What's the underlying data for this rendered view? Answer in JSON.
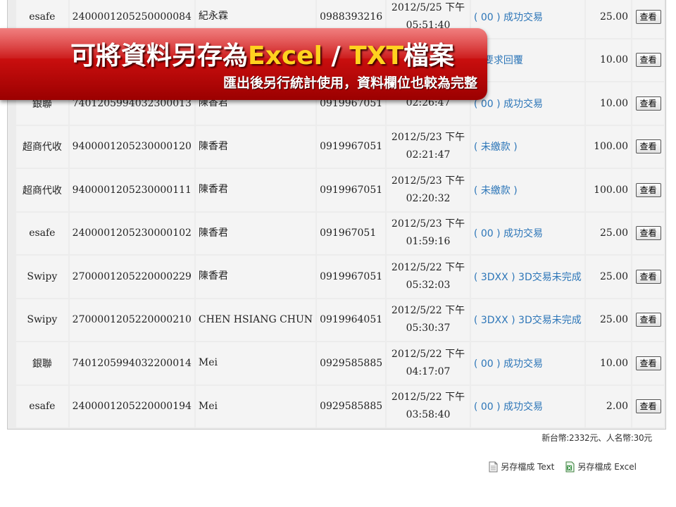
{
  "banner": {
    "title_part1": "可將資料另存為",
    "title_excel": "Excel",
    "title_sep": " / ",
    "title_txt": "TXT",
    "title_part2": "檔案",
    "subtitle": "匯出後另行統計使用，資料欄位也較為完整"
  },
  "rows": [
    {
      "method": "esafe",
      "order_no": "2400001205250000084",
      "name": "紀永霖",
      "phone": "0988393216",
      "date": "2012/5/25 下午",
      "time": "05:51:40",
      "status": "( 00 ) 成功交易",
      "amount": "25.00",
      "action": "查看"
    },
    {
      "method": "",
      "order_no": "",
      "name": "",
      "phone": "",
      "date": "",
      "time": "",
      "status": "行要求回覆",
      "amount": "10.00",
      "action": "查看"
    },
    {
      "method": "銀聯",
      "order_no": "7401205994032300013",
      "name": "陳香君",
      "phone": "0919967051",
      "date": "",
      "time": "02:26:47",
      "status": "( 00 ) 成功交易",
      "amount": "10.00",
      "action": "查看"
    },
    {
      "method": "超商代收",
      "order_no": "9400001205230000120",
      "name": "陳香君",
      "phone": "0919967051",
      "date": "2012/5/23 下午",
      "time": "02:21:47",
      "status": "( 未繳款 )",
      "amount": "100.00",
      "action": "查看"
    },
    {
      "method": "超商代收",
      "order_no": "9400001205230000111",
      "name": "陳香君",
      "phone": "0919967051",
      "date": "2012/5/23 下午",
      "time": "02:20:32",
      "status": "( 未繳款 )",
      "amount": "100.00",
      "action": "查看"
    },
    {
      "method": "esafe",
      "order_no": "2400001205230000102",
      "name": "陳香君",
      "phone": "091967051",
      "date": "2012/5/23 下午",
      "time": "01:59:16",
      "status": "( 00 ) 成功交易",
      "amount": "25.00",
      "action": "查看"
    },
    {
      "method": "Swipy",
      "order_no": "2700001205220000229",
      "name": "陳香君",
      "phone": "0919967051",
      "date": "2012/5/22 下午",
      "time": "05:32:03",
      "status": "( 3DXX ) 3D交易未完成",
      "amount": "25.00",
      "action": "查看"
    },
    {
      "method": "Swipy",
      "order_no": "2700001205220000210",
      "name": "CHEN HSIANG CHUN",
      "phone": "0919964051",
      "date": "2012/5/22 下午",
      "time": "05:30:37",
      "status": "( 3DXX ) 3D交易未完成",
      "amount": "25.00",
      "action": "查看"
    },
    {
      "method": "銀聯",
      "order_no": "7401205994032200014",
      "name": "Mei",
      "phone": "0929585885",
      "date": "2012/5/22 下午",
      "time": "04:17:07",
      "status": "( 00 ) 成功交易",
      "amount": "10.00",
      "action": "查看"
    },
    {
      "method": "esafe",
      "order_no": "2400001205220000194",
      "name": "Mei",
      "phone": "0929585885",
      "date": "2012/5/22 下午",
      "time": "03:58:40",
      "status": "( 00 ) 成功交易",
      "amount": "2.00",
      "action": "查看"
    }
  ],
  "totals": "新台幣:2332元、人名幣:30元",
  "save_text_label": "另存檔成 Text",
  "save_excel_label": "另存檔成 Excel",
  "icons": {
    "text_file": "text-file-icon",
    "excel_file": "excel-file-icon"
  },
  "colors": {
    "status_link": "#2d76b8",
    "banner_red": "#c80e0e",
    "banner_highlight": "#ffd21f"
  }
}
